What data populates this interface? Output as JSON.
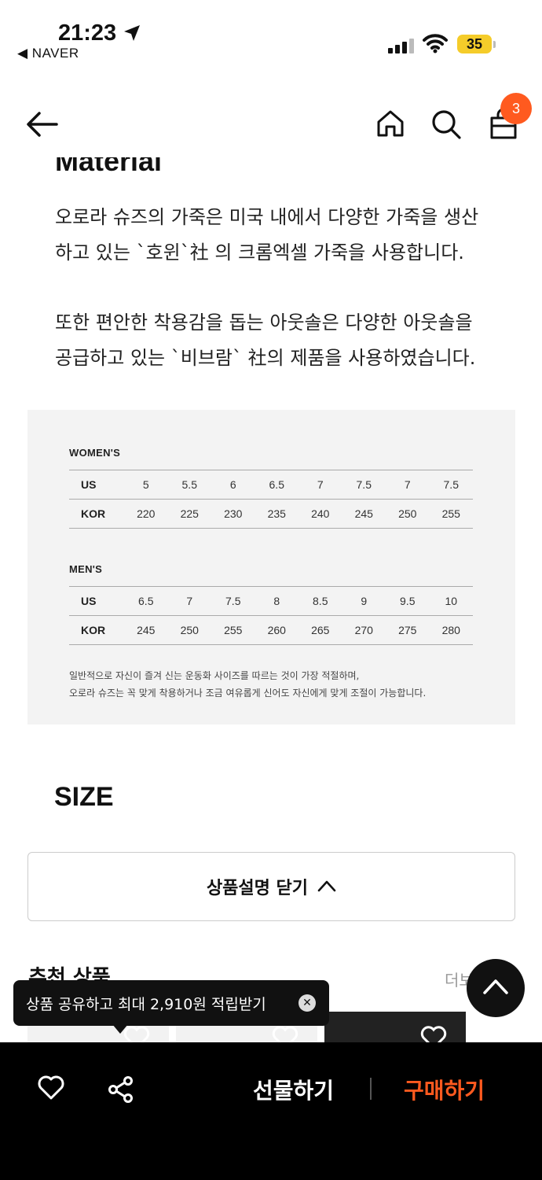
{
  "status_bar": {
    "time": "21:23",
    "back_app": "◀ NAVER",
    "battery": "35"
  },
  "nav": {
    "cart_count": "3"
  },
  "material": {
    "title": "Material",
    "paragraph_1": "오로라 슈즈의 가죽은 미국 내에서 다양한 가죽을 생산하고 있는 `호윈`社 의 크롬엑셀 가죽을 사용합니다.",
    "paragraph_2": "또한 편안한 착용감을 돕는 아웃솔은 다양한 아웃솔을 공급하고 있는 `비브람` 社의 제품을 사용하였습니다."
  },
  "size_chart": {
    "women_heading": "WOMEN'S",
    "women": {
      "us_label": "US",
      "kor_label": "KOR",
      "us": [
        "5",
        "5.5",
        "6",
        "6.5",
        "7",
        "7.5",
        "7",
        "7.5"
      ],
      "kor": [
        "220",
        "225",
        "230",
        "235",
        "240",
        "245",
        "250",
        "255"
      ]
    },
    "men_heading": "MEN'S",
    "men": {
      "us_label": "US",
      "kor_label": "KOR",
      "us": [
        "6.5",
        "7",
        "7.5",
        "8",
        "8.5",
        "9",
        "9.5",
        "10"
      ],
      "kor": [
        "245",
        "250",
        "255",
        "260",
        "265",
        "270",
        "275",
        "280"
      ]
    },
    "note_1": "일반적으로 자신이 즐겨 신는 운동화 사이즈를 따르는 것이 가장 적절하며,",
    "note_2": "오로라 슈즈는 꼭 맞게 착용하거나 조금 여유롭게 신어도 자신에게 맞게 조절이 가능합니다."
  },
  "size_title": "SIZE",
  "close_description": "상품설명 닫기",
  "recommend": {
    "title": "추천 상품",
    "more": "더보"
  },
  "share_tooltip": "상품 공유하고 최대 2,910원 적립받기",
  "bottom_bar": {
    "gift_label": "선물하기",
    "buy_label": "구매하기",
    "buy_color": "#ff5a1f"
  }
}
